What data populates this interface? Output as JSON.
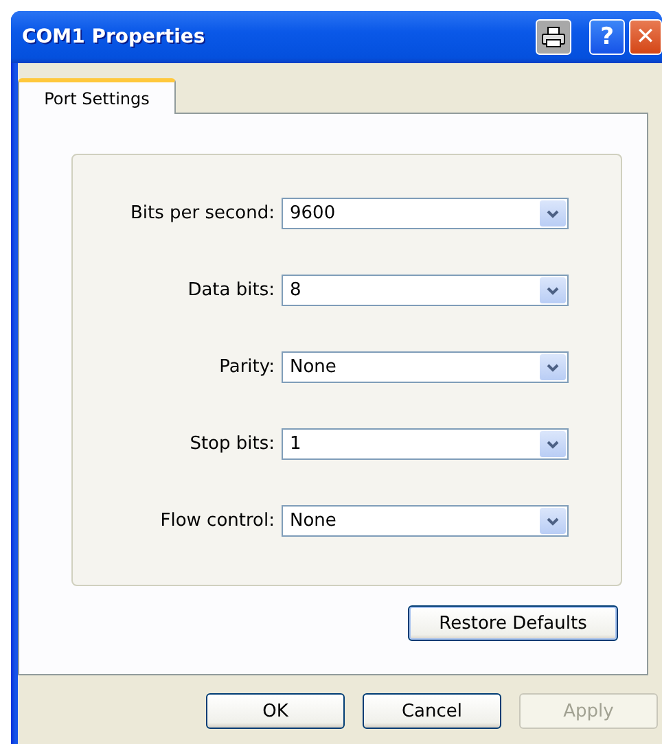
{
  "window": {
    "title": "COM1 Properties",
    "help_glyph": "?",
    "close_glyph": "✕"
  },
  "tabs": [
    {
      "label": "Port Settings",
      "selected": true
    }
  ],
  "fields": [
    {
      "label": "Bits per second:",
      "value": "9600"
    },
    {
      "label": "Data bits:",
      "value": "8"
    },
    {
      "label": "Parity:",
      "value": "None"
    },
    {
      "label": "Stop bits:",
      "value": "1"
    },
    {
      "label": "Flow control:",
      "value": "None"
    }
  ],
  "restore_button": {
    "label": "Restore Defaults",
    "disabled": false
  },
  "buttons": [
    {
      "label": "OK",
      "disabled": false
    },
    {
      "label": "Cancel",
      "disabled": false
    },
    {
      "label": "Apply",
      "disabled": true
    }
  ]
}
